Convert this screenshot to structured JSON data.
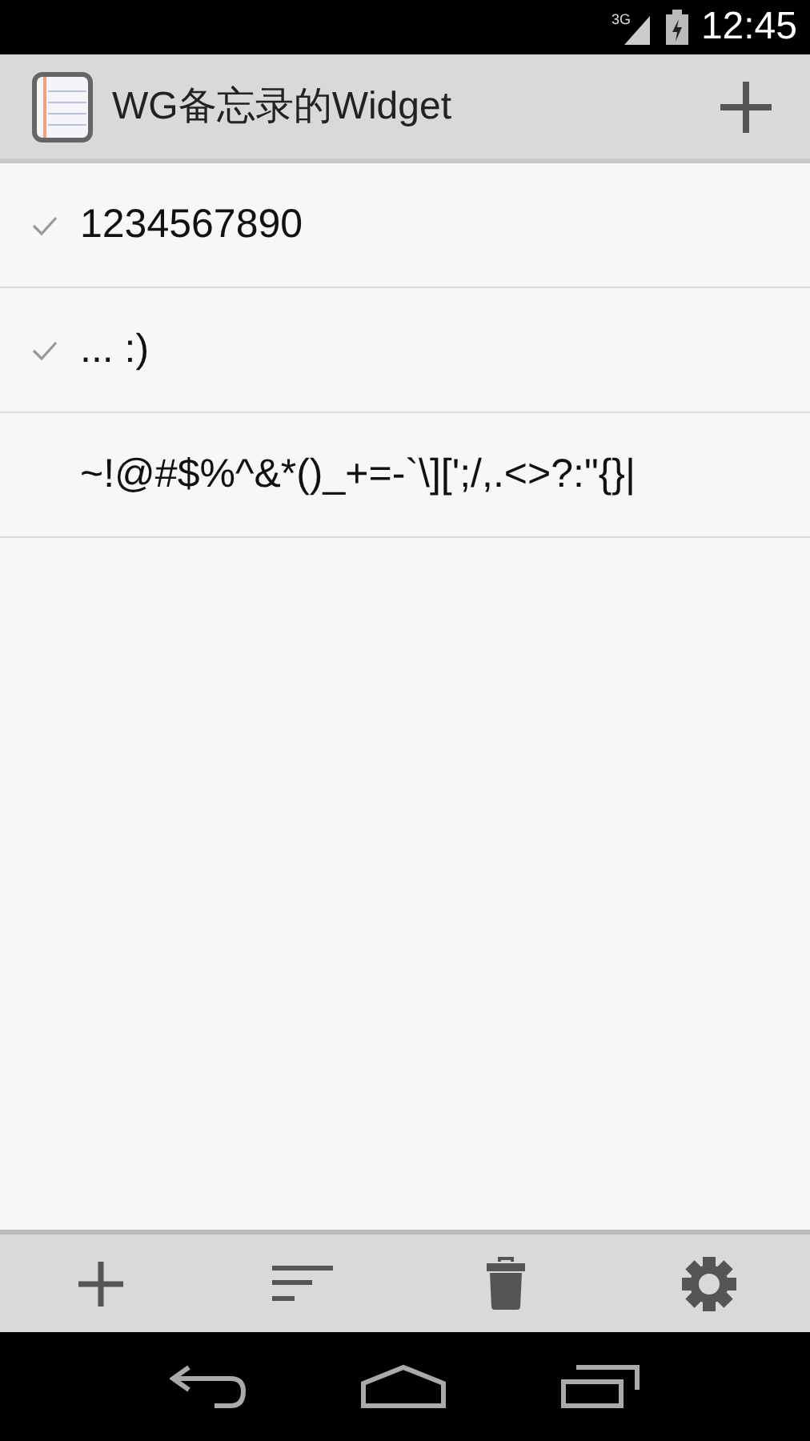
{
  "status_bar": {
    "network": "3G",
    "time": "12:45"
  },
  "action_bar": {
    "title": "WG备忘录的Widget"
  },
  "notes": [
    {
      "text": "1234567890",
      "checked": true
    },
    {
      "text": "... :)",
      "checked": true
    },
    {
      "text": "~!@#$%^&*()_+=-`\\][';/,.<>?:\"{}|",
      "checked": false
    }
  ]
}
